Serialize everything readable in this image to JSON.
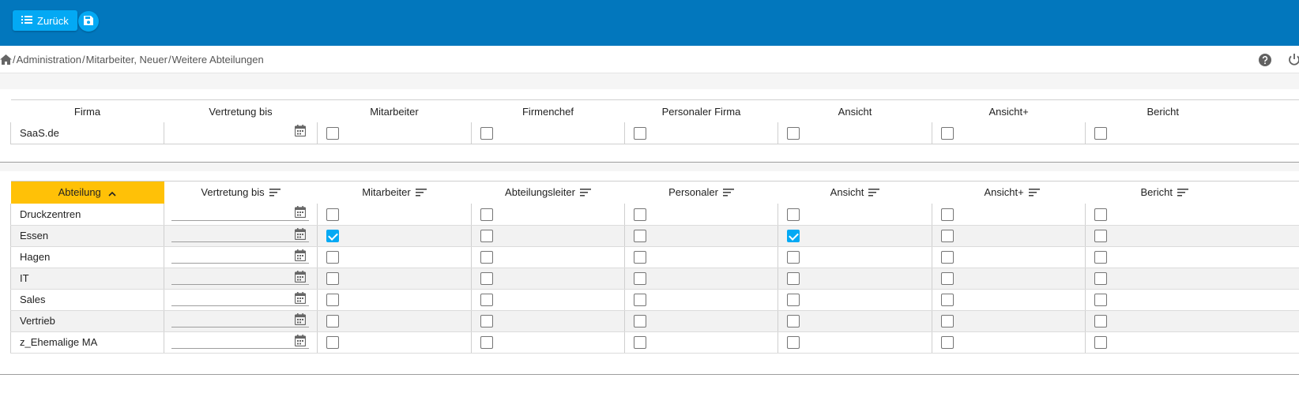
{
  "toolbar": {
    "back_label": "Zurück"
  },
  "breadcrumb": {
    "items": [
      "Administration",
      "Mitarbeiter, Neuer",
      "Weitere Abteilungen"
    ],
    "separator": "/"
  },
  "colors": {
    "topbar": "#0277bd",
    "button": "#03a9f4",
    "sort_header": "#ffc107",
    "checkbox_checked": "#03a9f4"
  },
  "company_table": {
    "headers": [
      "Firma",
      "Vertretung bis",
      "Mitarbeiter",
      "Firmenchef",
      "Personaler Firma",
      "Ansicht",
      "Ansicht+",
      "Bericht"
    ],
    "row": {
      "name": "SaaS.de",
      "checks": [
        false,
        false,
        false,
        false,
        false,
        false
      ]
    }
  },
  "department_table": {
    "headers": [
      "Abteilung",
      "Vertretung bis",
      "Mitarbeiter",
      "Abteilungsleiter",
      "Personaler",
      "Ansicht",
      "Ansicht+",
      "Bericht"
    ],
    "sorted_column": "Abteilung",
    "sort_direction": "ascending",
    "rows": [
      {
        "name": "Druckzentren",
        "checks": [
          false,
          false,
          false,
          false,
          false,
          false
        ]
      },
      {
        "name": "Essen",
        "checks": [
          true,
          false,
          false,
          true,
          false,
          false
        ]
      },
      {
        "name": "Hagen",
        "checks": [
          false,
          false,
          false,
          false,
          false,
          false
        ]
      },
      {
        "name": "IT",
        "checks": [
          false,
          false,
          false,
          false,
          false,
          false
        ]
      },
      {
        "name": "Sales",
        "checks": [
          false,
          false,
          false,
          false,
          false,
          false
        ]
      },
      {
        "name": "Vertrieb",
        "checks": [
          false,
          false,
          false,
          false,
          false,
          false
        ]
      },
      {
        "name": "z_Ehemalige MA",
        "checks": [
          false,
          false,
          false,
          false,
          false,
          false
        ]
      }
    ]
  }
}
